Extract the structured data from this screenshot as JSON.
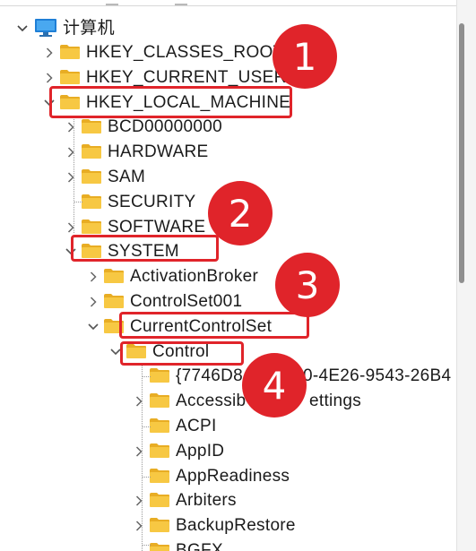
{
  "tree": {
    "root": {
      "label": "计算机",
      "icon": "computer-icon"
    },
    "items": [
      {
        "label": "HKEY_CLASSES_ROOT",
        "level": 1,
        "expander": "collapsed"
      },
      {
        "label": "HKEY_CURRENT_USER",
        "level": 1,
        "expander": "collapsed"
      },
      {
        "label": "HKEY_LOCAL_MACHINE",
        "level": 1,
        "expander": "expanded"
      },
      {
        "label": "BCD00000000",
        "level": 2,
        "expander": "collapsed"
      },
      {
        "label": "HARDWARE",
        "level": 2,
        "expander": "collapsed"
      },
      {
        "label": "SAM",
        "level": 2,
        "expander": "collapsed"
      },
      {
        "label": "SECURITY",
        "level": 2,
        "expander": "none"
      },
      {
        "label": "SOFTWARE",
        "level": 2,
        "expander": "collapsed"
      },
      {
        "label": "SYSTEM",
        "level": 2,
        "expander": "expanded"
      },
      {
        "label": "ActivationBroker",
        "level": 3,
        "expander": "collapsed"
      },
      {
        "label": "ControlSet001",
        "level": 3,
        "expander": "collapsed"
      },
      {
        "label": "CurrentControlSet",
        "level": 3,
        "expander": "expanded"
      },
      {
        "label": "Control",
        "level": 4,
        "expander": "expanded"
      },
      {
        "label": "{7746D8",
        "level": 5,
        "expander": "none",
        "suffix": "E0-4E26-9543-26B4"
      },
      {
        "label": "Accessib",
        "level": 5,
        "expander": "collapsed",
        "suffix": "ettings"
      },
      {
        "label": "ACPI",
        "level": 5,
        "expander": "none"
      },
      {
        "label": "AppID",
        "level": 5,
        "expander": "collapsed"
      },
      {
        "label": "AppReadiness",
        "level": 5,
        "expander": "none"
      },
      {
        "label": "Arbiters",
        "level": 5,
        "expander": "collapsed"
      },
      {
        "label": "BackupRestore",
        "level": 5,
        "expander": "collapsed"
      },
      {
        "label": "BGFX",
        "level": 5,
        "expander": "none"
      }
    ]
  },
  "annotations": {
    "color": "#e0242a",
    "steps": [
      "1",
      "2",
      "3",
      "4"
    ]
  },
  "colors": {
    "folder_body": "#f7c843",
    "folder_tab": "#e8ad24",
    "highlight": "#e0242a"
  }
}
